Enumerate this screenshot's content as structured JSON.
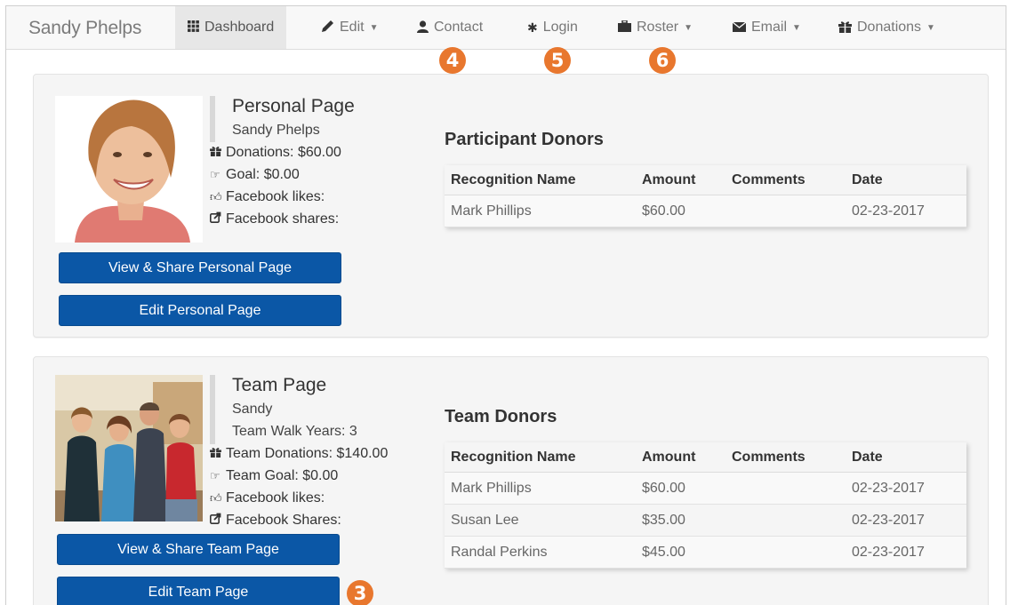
{
  "navbar": {
    "brand": "Sandy Phelps",
    "items": [
      {
        "label": "Dashboard",
        "icon": "grid-icon"
      },
      {
        "label": "Edit",
        "icon": "pencil-icon"
      },
      {
        "label": "Contact",
        "icon": "user-icon"
      },
      {
        "label": "Login",
        "icon": "asterisk-icon"
      },
      {
        "label": "Roster",
        "icon": "briefcase-icon"
      },
      {
        "label": "Email",
        "icon": "envelope-icon"
      },
      {
        "label": "Donations",
        "icon": "gift-icon"
      }
    ]
  },
  "callouts": {
    "contact": "4",
    "login": "5",
    "roster": "6",
    "edit_team": "3"
  },
  "personal": {
    "title": "Personal Page",
    "name": "Sandy Phelps",
    "donations": "Donations: $60.00",
    "goal": "Goal: $0.00",
    "fb_likes": "Facebook likes:",
    "fb_shares": "Facebook shares:",
    "view_button": "View & Share Personal Page",
    "edit_button": "Edit Personal Page",
    "donors_title": "Participant Donors",
    "columns": [
      "Recognition Name",
      "Amount",
      "Comments",
      "Date"
    ],
    "rows": [
      {
        "name": "Mark Phillips",
        "amount": "$60.00",
        "comments": "",
        "date": "02-23-2017"
      }
    ]
  },
  "team": {
    "title": "Team Page",
    "name": "Sandy",
    "walk_years": "Team Walk Years: 3",
    "donations": "Team Donations: $140.00",
    "goal": "Team Goal: $0.00",
    "fb_likes": "Facebook likes:",
    "fb_shares": "Facebook Shares:",
    "view_button": "View & Share Team Page",
    "edit_button": "Edit Team Page",
    "donors_title": "Team Donors",
    "columns": [
      "Recognition Name",
      "Amount",
      "Comments",
      "Date"
    ],
    "rows": [
      {
        "name": "Mark Phillips",
        "amount": "$60.00",
        "comments": "",
        "date": "02-23-2017"
      },
      {
        "name": "Susan Lee",
        "amount": "$35.00",
        "comments": "",
        "date": "02-23-2017"
      },
      {
        "name": "Randal Perkins",
        "amount": "$45.00",
        "comments": "",
        "date": "02-23-2017"
      }
    ]
  },
  "colors": {
    "accent": "#0b57a6",
    "callout": "#e8772e",
    "panel": "#f5f5f5"
  }
}
